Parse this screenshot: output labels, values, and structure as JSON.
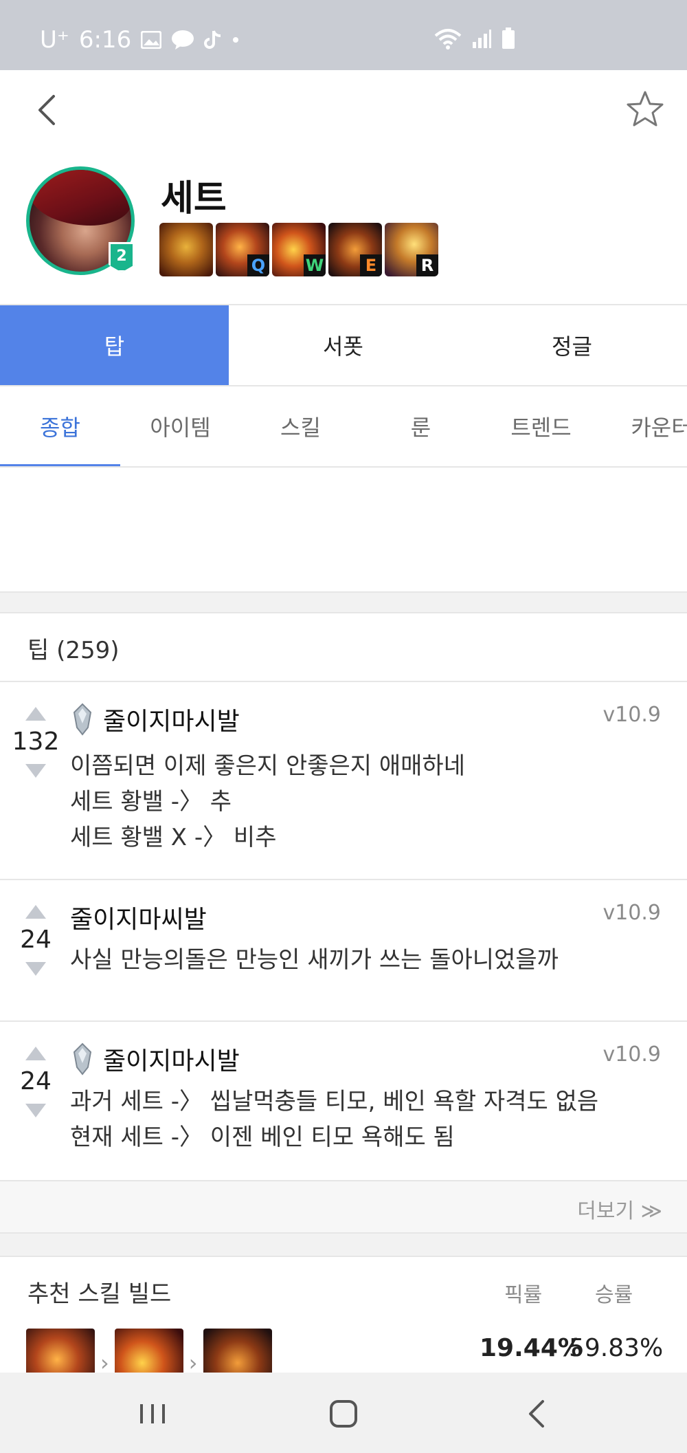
{
  "status": {
    "carrier": "U⁺",
    "time": "6:16"
  },
  "champion": {
    "name": "세트",
    "rank": "2",
    "skill_keys": [
      "Q",
      "W",
      "E",
      "R"
    ]
  },
  "role_tabs": [
    {
      "label": "탑"
    },
    {
      "label": "서폿"
    },
    {
      "label": "정글"
    }
  ],
  "sub_tabs": [
    {
      "label": "종합"
    },
    {
      "label": "아이템"
    },
    {
      "label": "스킬"
    },
    {
      "label": "룬"
    },
    {
      "label": "트렌드"
    },
    {
      "label": "카운터"
    }
  ],
  "tips": {
    "title": "팁 (259)",
    "items": [
      {
        "votes": "132",
        "author": "줄이지마시발",
        "version": "v10.9",
        "lines": [
          "이쯤되면 이제 좋은지 안좋은지 애매하네",
          "세트 황밸 -〉 추",
          "세트 황밸 X -〉 비추"
        ]
      },
      {
        "votes": "24",
        "author": "줄이지마씨발",
        "version": "v10.9",
        "lines": [
          "사실 만능의돌은 만능인 새끼가 쓰는 돌아니었을까"
        ]
      },
      {
        "votes": "24",
        "author": "줄이지마시발",
        "version": "v10.9",
        "lines": [
          "과거 세트 -〉 씹날먹충들 티모, 베인 욕할 자격도 없음",
          "현재 세트 -〉 이젠 베인 티모 욕해도 됨"
        ]
      }
    ],
    "more_label": "더보기 ≫"
  },
  "skill_build": {
    "title": "추천 스킬 빌드",
    "pick_header": "픽률",
    "win_header": "승률",
    "pick_rate": "19.44%",
    "win_rate": "59.83%"
  },
  "colors": {
    "accent": "#5383e8",
    "rank_badge": "#19b58c"
  }
}
